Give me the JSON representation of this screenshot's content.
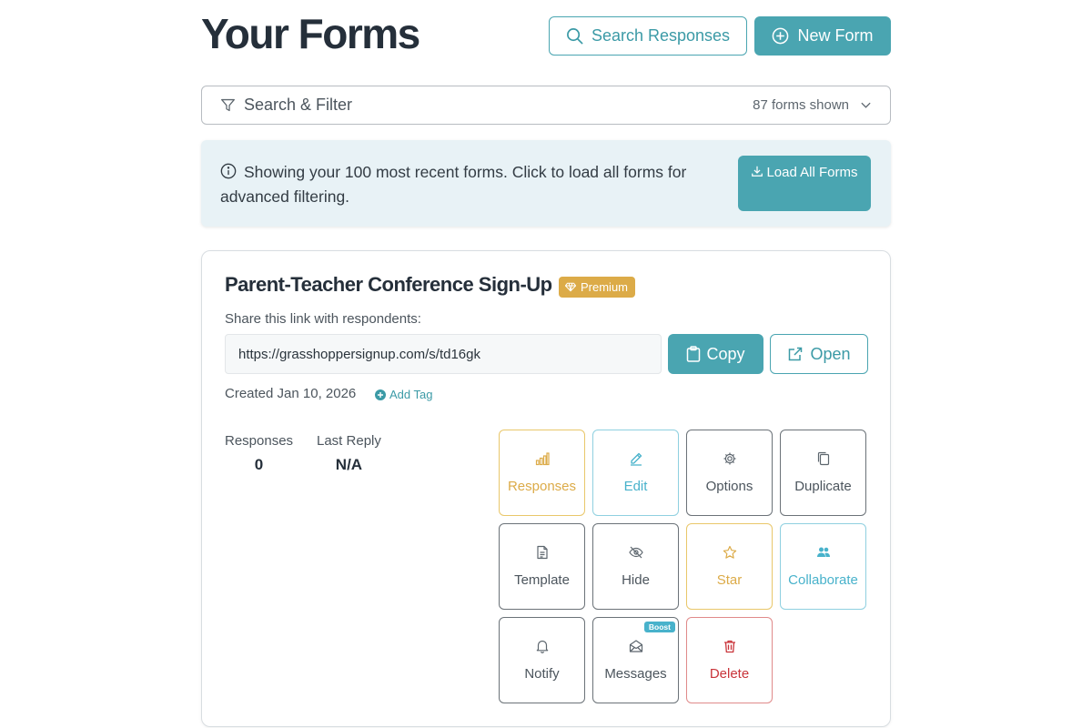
{
  "header": {
    "title": "Your Forms",
    "search_responses_label": "Search Responses",
    "new_form_label": "New Form"
  },
  "filter": {
    "label": "Search & Filter",
    "count": "87 forms shown"
  },
  "banner": {
    "text": "Showing your 100 most recent forms. Click to load all forms for advanced filtering.",
    "load_all_label": "Load All Forms"
  },
  "form": {
    "title": "Parent-Teacher Conference Sign-Up",
    "badge": "Premium",
    "share_label": "Share this link with respondents:",
    "link": "https://grasshoppersignup.com/s/td16gk",
    "copy_label": "Copy",
    "open_label": "Open",
    "created": "Created Jan 10, 2026",
    "add_tag_label": "Add Tag",
    "stats": {
      "responses_label": "Responses",
      "responses_value": "0",
      "last_reply_label": "Last Reply",
      "last_reply_value": "N/A"
    },
    "actions": [
      {
        "label": "Responses",
        "icon": "bar-chart-icon",
        "tone": "gold"
      },
      {
        "label": "Edit",
        "icon": "pencil-icon",
        "tone": "cyan"
      },
      {
        "label": "Options",
        "icon": "gear-icon",
        "tone": "gray"
      },
      {
        "label": "Duplicate",
        "icon": "duplicate-icon",
        "tone": "gray"
      },
      {
        "label": "Template",
        "icon": "document-icon",
        "tone": "gray"
      },
      {
        "label": "Hide",
        "icon": "eye-off-icon",
        "tone": "gray"
      },
      {
        "label": "Star",
        "icon": "star-icon",
        "tone": "gold"
      },
      {
        "label": "Collaborate",
        "icon": "users-icon",
        "tone": "cyan"
      },
      {
        "label": "Notify",
        "icon": "bell-icon",
        "tone": "gray"
      },
      {
        "label": "Messages",
        "icon": "envelope-icon",
        "tone": "gray",
        "badge": "Boost"
      },
      {
        "label": "Delete",
        "icon": "trash-icon",
        "tone": "red"
      }
    ]
  },
  "colors": {
    "accent": "#4aa5b1",
    "premium": "#dcab48",
    "info_bg": "#e8f2f6",
    "danger": "#c9343a",
    "collab": "#48b2cb"
  }
}
